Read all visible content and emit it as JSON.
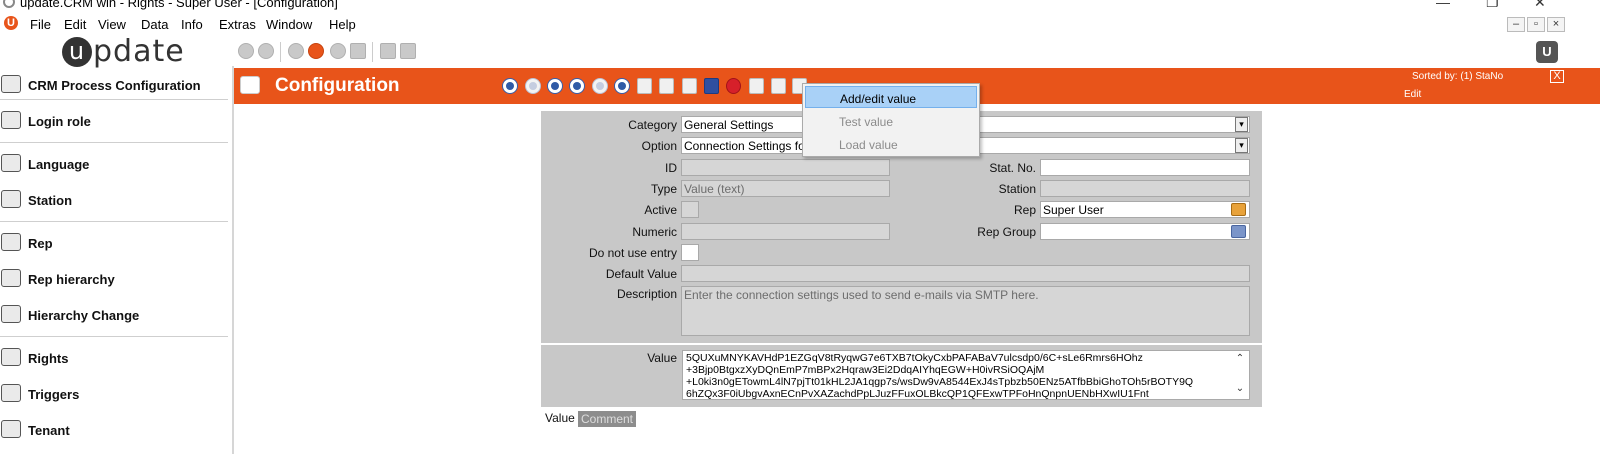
{
  "window": {
    "title": "update.CRM win - Rights - Super User - [Configuration]"
  },
  "menubar": {
    "items": [
      "File",
      "Edit",
      "View",
      "Data",
      "Info",
      "Extras",
      "Window",
      "Help"
    ]
  },
  "brand": {
    "text": "pdate"
  },
  "sidebar": {
    "items": [
      {
        "label": "CRM Process Configuration",
        "icon": "gear-icon"
      },
      {
        "label": "Login role",
        "icon": "user-icon"
      },
      {
        "label": "Language",
        "icon": "keyboard-icon"
      },
      {
        "label": "Station",
        "icon": "monitor-icon"
      },
      {
        "label": "Rep",
        "icon": "person-icon"
      },
      {
        "label": "Rep hierarchy",
        "icon": "hierarchy-icon"
      },
      {
        "label": "Hierarchy Change",
        "icon": "hierarchy-icon"
      },
      {
        "label": "Rights",
        "icon": "rights-icon"
      },
      {
        "label": "Triggers",
        "icon": "trigger-icon"
      },
      {
        "label": "Tenant",
        "icon": "tenant-icon"
      }
    ]
  },
  "header": {
    "title": "Configuration",
    "sorted_by": "Sorted by: (1) StaNo",
    "edit": "Edit",
    "close": "X"
  },
  "form": {
    "category": {
      "label": "Category",
      "value": "General Settings"
    },
    "option": {
      "label": "Option",
      "value": "Connection Settings for"
    },
    "id": {
      "label": "ID",
      "value": ""
    },
    "type": {
      "label": "Type",
      "value": "Value (text)"
    },
    "active": {
      "label": "Active"
    },
    "numeric": {
      "label": "Numeric",
      "value": ""
    },
    "do_not_use": {
      "label": "Do not use entry"
    },
    "default_value": {
      "label": "Default Value",
      "value": ""
    },
    "description": {
      "label": "Description",
      "value": "Enter the connection settings used to send e-mails via SMTP here."
    },
    "stat_no": {
      "label": "Stat. No.",
      "value": ""
    },
    "station": {
      "label": "Station",
      "value": ""
    },
    "rep": {
      "label": "Rep",
      "value": "Super User"
    },
    "rep_group": {
      "label": "Rep Group",
      "value": ""
    },
    "value": {
      "label": "Value",
      "lines": [
        "5QUXuMNYKAVHdP1EZGqV8tRyqwG7e6TXB7tOkyCxbPAFABaV7ulcsdp0/6C+sLe6Rmrs6HOhz",
        "+3Bjp0BtgxzXyDQnEmP7mBPx2Hqraw3Ei2DdqAIYhqEGW+H0ivRSiOQAjM",
        "+L0ki3n0gETowmL4lN7pjTt01kHL2JA1qgp7s/wsDw9vA8544ExJ4sTpbzb50ENz5ATfbBbiGhoTOh5rBOTY9Q",
        "6hZQx3F0iUbgvAxnECnPvXAZachdPpLJuzFFuxOLBkcQP1QFExwTPFoHnQnpnUENbHXwIU1Fnt"
      ]
    }
  },
  "tabs": {
    "value": "Value",
    "comment": "Comment"
  },
  "context_menu": {
    "items": [
      "Add/edit value",
      "Test value",
      "Load value"
    ]
  }
}
